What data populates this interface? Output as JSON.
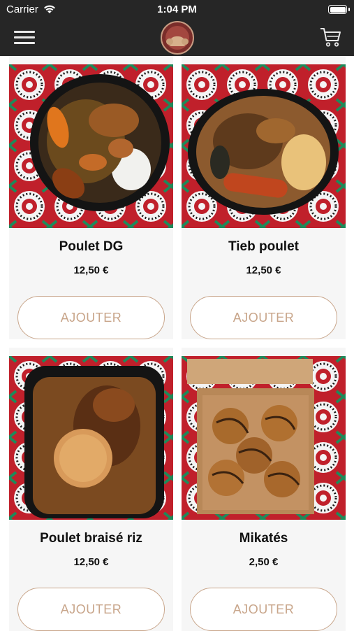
{
  "status_bar": {
    "carrier": "Carrier",
    "time": "1:04 PM"
  },
  "nav": {
    "menu_icon": "hamburger-menu-icon",
    "logo": "restaurant-logo",
    "cart_icon": "shopping-cart-icon"
  },
  "products": [
    {
      "name": "Poulet DG",
      "price": "12,50 €",
      "button_label": "AJOUTER",
      "image": "poulet-dg-photo"
    },
    {
      "name": "Tieb poulet",
      "price": "12,50 €",
      "button_label": "AJOUTER",
      "image": "tieb-poulet-photo"
    },
    {
      "name": "Poulet braisé riz",
      "price": "12,50 €",
      "button_label": "AJOUTER",
      "image": "poulet-braise-riz-photo"
    },
    {
      "name": "Mikatés",
      "price": "2,50 €",
      "button_label": "AJOUTER",
      "image": "mikates-photo"
    }
  ],
  "colors": {
    "bar": "#262626",
    "accent": "#c8a58a",
    "card": "#f6f6f6",
    "fabric_red": "#c0202b"
  }
}
